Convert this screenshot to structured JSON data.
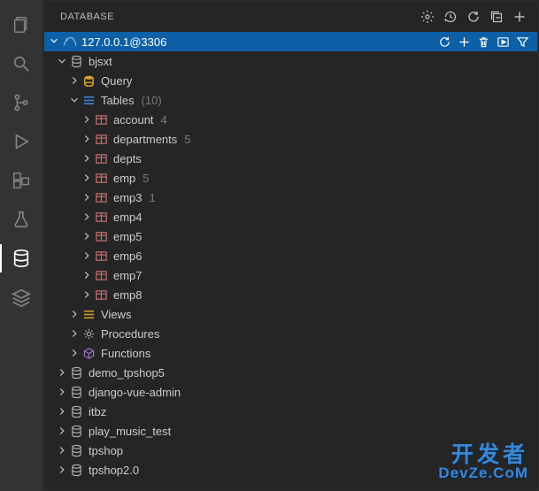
{
  "panel_title": "DATABASE",
  "activity_bar": [
    {
      "name": "explorer-icon"
    },
    {
      "name": "search-icon"
    },
    {
      "name": "source-control-icon"
    },
    {
      "name": "run-debug-icon"
    },
    {
      "name": "extensions-icon"
    },
    {
      "name": "testing-icon"
    },
    {
      "name": "database-icon",
      "active": true
    },
    {
      "name": "layers-icon"
    }
  ],
  "header_actions": [
    {
      "name": "settings-icon"
    },
    {
      "name": "history-icon"
    },
    {
      "name": "refresh-icon"
    },
    {
      "name": "collapse-all-icon"
    },
    {
      "name": "add-icon"
    }
  ],
  "connection": {
    "label": "127.0.0.1@3306",
    "icon": "mysql-icon",
    "expanded": true,
    "actions": [
      {
        "name": "refresh-icon"
      },
      {
        "name": "add-icon"
      },
      {
        "name": "delete-icon"
      },
      {
        "name": "run-icon"
      },
      {
        "name": "filter-icon"
      }
    ]
  },
  "tree": [
    {
      "depth": 1,
      "expanded": true,
      "icon": "database",
      "label": "bjsxt"
    },
    {
      "depth": 2,
      "expanded": false,
      "icon": "query",
      "label": "Query"
    },
    {
      "depth": 2,
      "expanded": true,
      "icon": "tables",
      "label": "Tables",
      "count": "(10)"
    },
    {
      "depth": 3,
      "expanded": false,
      "icon": "table",
      "label": "account",
      "count": "4"
    },
    {
      "depth": 3,
      "expanded": false,
      "icon": "table",
      "label": "departments",
      "count": "5"
    },
    {
      "depth": 3,
      "expanded": false,
      "icon": "table",
      "label": "depts"
    },
    {
      "depth": 3,
      "expanded": false,
      "icon": "table",
      "label": "emp",
      "count": "5"
    },
    {
      "depth": 3,
      "expanded": false,
      "icon": "table",
      "label": "emp3",
      "count": "1"
    },
    {
      "depth": 3,
      "expanded": false,
      "icon": "table",
      "label": "emp4"
    },
    {
      "depth": 3,
      "expanded": false,
      "icon": "table",
      "label": "emp5"
    },
    {
      "depth": 3,
      "expanded": false,
      "icon": "table",
      "label": "emp6"
    },
    {
      "depth": 3,
      "expanded": false,
      "icon": "table",
      "label": "emp7"
    },
    {
      "depth": 3,
      "expanded": false,
      "icon": "table",
      "label": "emp8"
    },
    {
      "depth": 2,
      "expanded": false,
      "icon": "views",
      "label": "Views"
    },
    {
      "depth": 2,
      "expanded": false,
      "icon": "procedures",
      "label": "Procedures"
    },
    {
      "depth": 2,
      "expanded": false,
      "icon": "functions",
      "label": "Functions"
    },
    {
      "depth": 1,
      "expanded": false,
      "icon": "database",
      "label": "demo_tpshop5"
    },
    {
      "depth": 1,
      "expanded": false,
      "icon": "database",
      "label": "django-vue-admin"
    },
    {
      "depth": 1,
      "expanded": false,
      "icon": "database",
      "label": "itbz"
    },
    {
      "depth": 1,
      "expanded": false,
      "icon": "database",
      "label": "play_music_test"
    },
    {
      "depth": 1,
      "expanded": false,
      "icon": "database",
      "label": "tpshop"
    },
    {
      "depth": 1,
      "expanded": false,
      "icon": "database",
      "label": "tpshop2.0"
    }
  ],
  "watermark": {
    "cn": "开发者",
    "en": "DevZe.CoM"
  }
}
